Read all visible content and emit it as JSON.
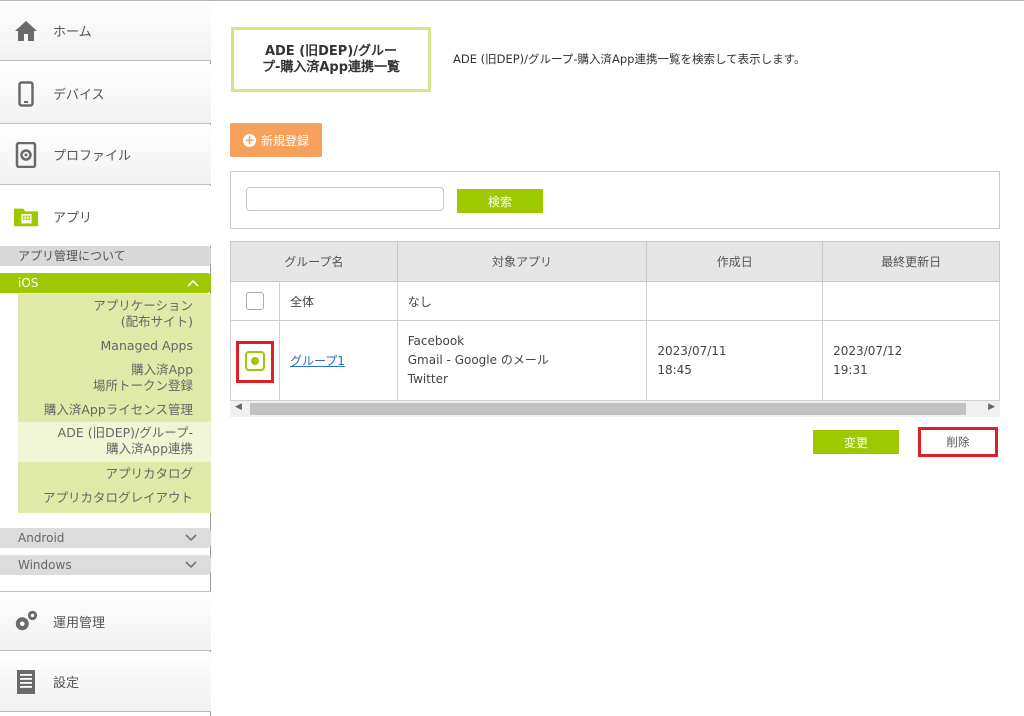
{
  "sidebar": {
    "home": "ホーム",
    "device": "デバイス",
    "profile": "プロファイル",
    "app": "アプリ",
    "app_about": "アプリ管理について",
    "ios": "iOS",
    "ios_items": [
      "アプリケーション",
      "(配布サイト)",
      "Managed Apps",
      "購入済App",
      "場所トークン登録",
      "購入済Appライセンス管理",
      "ADE (旧DEP)/グループ-",
      "購入済App連携",
      "アプリカタログ",
      "アプリカタログレイアウト"
    ],
    "android": "Android",
    "windows": "Windows",
    "operations": "運用管理",
    "settings": "設定"
  },
  "main": {
    "title_line1": "ADE (旧DEP)/グルー",
    "title_line2": "プ-購入済App連携一覧",
    "description": "ADE (旧DEP)/グループ-購入済App連携一覧を検索して表示します。",
    "new_button": "新規登録",
    "search_button": "検索",
    "search_value": "",
    "columns": [
      "グループ名",
      "対象アプリ",
      "作成日",
      "最終更新日"
    ],
    "rows": [
      {
        "group": "全体",
        "apps": [
          "なし"
        ],
        "created": [
          "",
          ""
        ],
        "updated": [
          "",
          ""
        ]
      },
      {
        "group": "グループ1",
        "apps": [
          "Facebook",
          "Gmail - Google のメール",
          "Twitter"
        ],
        "created": [
          "2023/07/11",
          "18:45"
        ],
        "updated": [
          "2023/07/12",
          "19:31"
        ]
      }
    ],
    "change_button": "変更",
    "delete_button": "削除"
  },
  "colors": {
    "accent": "#9ec800",
    "new_button": "#f5a15c",
    "highlight": "#dd1f28",
    "link": "#2a6bd1"
  }
}
